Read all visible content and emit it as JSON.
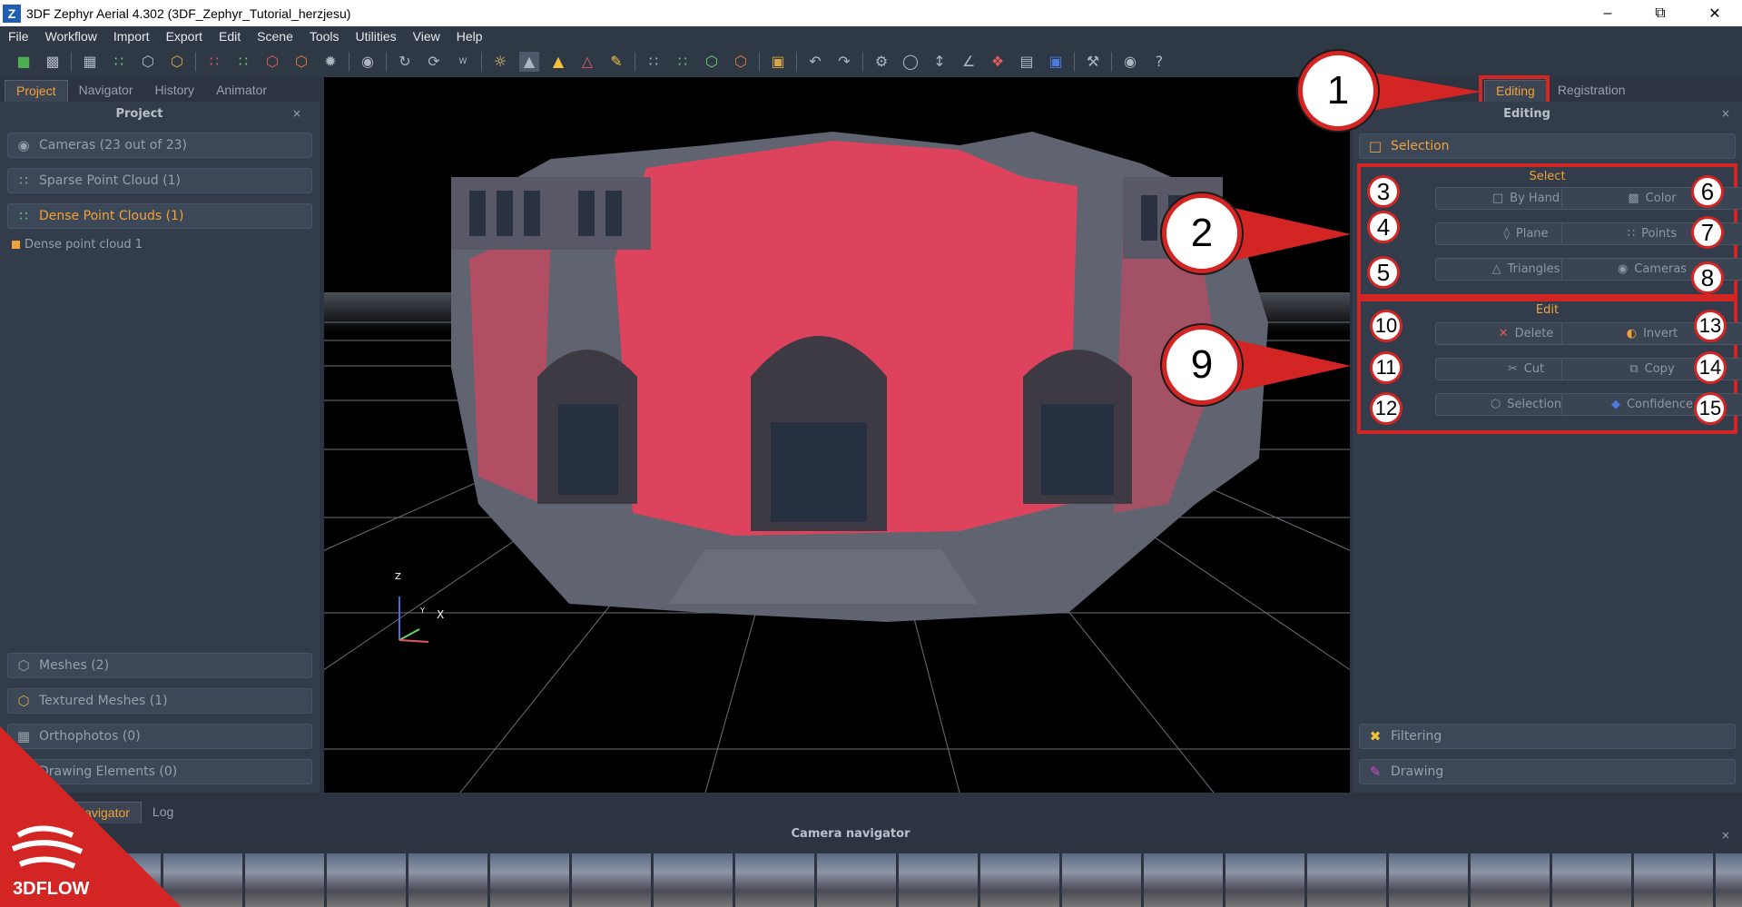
{
  "window": {
    "title": "3DF Zephyr Aerial 4.302 (3DF_Zephyr_Tutorial_herzjesu)",
    "logo_letter": "Z"
  },
  "menu": [
    "File",
    "Workflow",
    "Import",
    "Export",
    "Edit",
    "Scene",
    "Tools",
    "Utilities",
    "View",
    "Help"
  ],
  "left_tabs": [
    "Project",
    "Navigator",
    "History",
    "Animator"
  ],
  "project": {
    "header": "Project",
    "close": "×",
    "cameras": "Cameras (23 out of 23)",
    "sparse": "Sparse Point Cloud (1)",
    "dense": "Dense Point Clouds (1)",
    "dense_item": "Dense point cloud 1",
    "meshes": "Meshes (2)",
    "textured": "Textured Meshes (1)",
    "orthophotos": "Orthophotos (0)",
    "drawing_elements": "Drawing Elements (0)"
  },
  "right_tabs": [
    "Editing",
    "Registration"
  ],
  "editing": {
    "header": "Editing",
    "close": "×",
    "selection_section": "Selection",
    "select_title": "Select",
    "select_buttons": [
      "By Hand",
      "Color",
      "Plane",
      "Points",
      "Triangles",
      "Cameras"
    ],
    "edit_title": "Edit",
    "edit_buttons": [
      "Delete",
      "Invert",
      "Cut",
      "Copy",
      "Selection",
      "Confidence"
    ],
    "filtering": "Filtering",
    "drawing": "Drawing"
  },
  "callouts": {
    "big": [
      "1",
      "2",
      "9"
    ],
    "small": [
      "3",
      "4",
      "5",
      "6",
      "7",
      "8",
      "10",
      "11",
      "12",
      "13",
      "14",
      "15"
    ]
  },
  "axes": {
    "z": "Z",
    "y": "Y",
    "x": "X"
  },
  "bottom_tabs": [
    "Navigator",
    "Log"
  ],
  "camera_navigator": {
    "title": "Camera navigator",
    "close": "×"
  },
  "brand": {
    "name": "3DFLOW"
  },
  "colors": {
    "accent": "#f2a23a",
    "callout_red": "#d42525",
    "selection_pink": "#e8405a"
  }
}
